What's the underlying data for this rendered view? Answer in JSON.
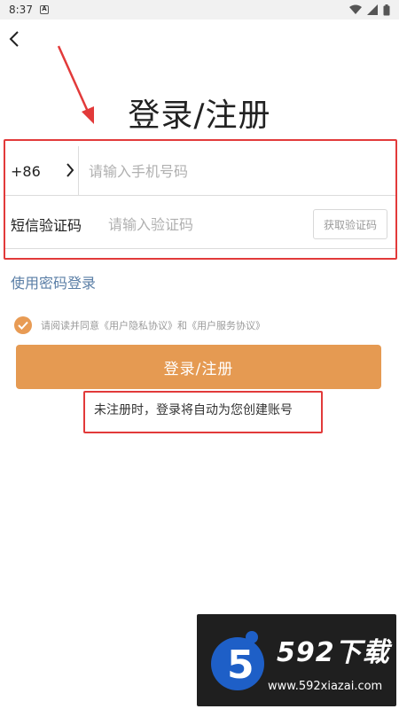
{
  "status_bar": {
    "time": "8:37",
    "notification_badge": "A"
  },
  "header": {
    "title": "登录/注册"
  },
  "phone_row": {
    "country_code": "+86",
    "placeholder": "请输入手机号码"
  },
  "sms_row": {
    "label": "短信验证码",
    "placeholder": "请输入验证码",
    "get_code_label": "获取验证码"
  },
  "password_login_link": "使用密码登录",
  "agreement": {
    "checked": true,
    "text": "请阅读并同意《用户隐私协议》和《用户服务协议》"
  },
  "submit_button": {
    "label": "登录/注册"
  },
  "hint": "未注册时，登录将自动为您创建账号",
  "watermark": {
    "brand": "592下载",
    "url": "www.592xiazai.com"
  },
  "colors": {
    "accent": "#e59a52",
    "annotation_red": "#e23a3a",
    "link": "#5a7ea6"
  },
  "icons": [
    "back-arrow-icon",
    "chevron-right-icon",
    "check-icon",
    "wifi-icon",
    "signal-icon",
    "battery-icon"
  ]
}
